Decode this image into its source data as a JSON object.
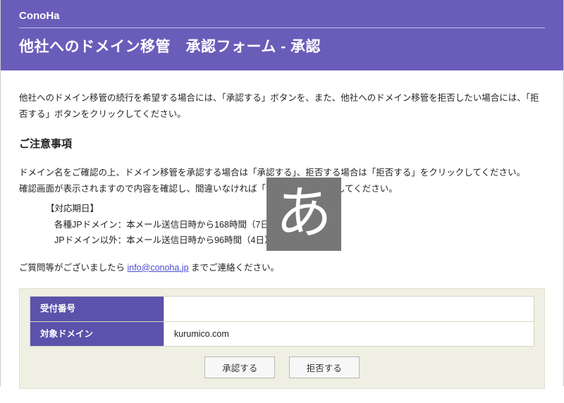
{
  "header": {
    "brand": "ConoHa",
    "title": "他社へのドメイン移管　承認フォーム - 承認"
  },
  "content": {
    "intro": "他社へのドメイン移管の続行を希望する場合には、「承認する」ボタンを、また、他社へのドメイン移管を拒否したい場合には、「拒否する」ボタンをクリックしてください。",
    "notice_heading": "ご注意事項",
    "notice_line1": "ドメイン名をご確認の上、ドメイン移管を承認する場合は「承認する」、拒否する場合は「拒否する」をクリックしてください。",
    "notice_line2": "確認画面が表示されますので内容を確認し、間違いなければ「決定」をクリックしてください。",
    "deadline_head": "【対応期日】",
    "deadline_jp": "各種JPドメイン：本メール送信日時から168時間（7日）以内",
    "deadline_other": "JPドメイン以外：本メール送信日時から96時間（4日）以内",
    "contact_pre": "ご質問等がございましたら ",
    "contact_email": "info@conoha.jp",
    "contact_post": " までご連絡ください。"
  },
  "table": {
    "rows": [
      {
        "label": "受付番号",
        "value": ""
      },
      {
        "label": "対象ドメイン",
        "value": "kurumico.com"
      }
    ]
  },
  "buttons": {
    "approve": "承認する",
    "reject": "拒否する"
  },
  "overlay": {
    "ime_badge": "あ"
  }
}
